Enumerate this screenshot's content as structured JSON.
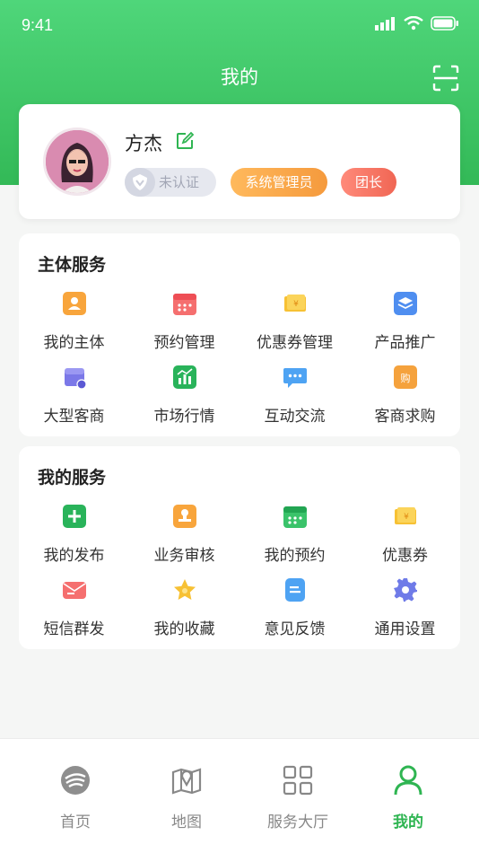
{
  "status_bar": {
    "time": "9:41"
  },
  "header": {
    "title": "我的"
  },
  "profile": {
    "name": "方杰",
    "badges": {
      "verify": "未认证",
      "role": "系统管理员",
      "leader": "团长"
    },
    "avatar_signature": "Linda"
  },
  "sections": {
    "main_services": {
      "title": "主体服务",
      "items": [
        {
          "label": "我的主体",
          "icon": "person-card-icon"
        },
        {
          "label": "预约管理",
          "icon": "calendar-icon"
        },
        {
          "label": "优惠券管理",
          "icon": "coupon-icon"
        },
        {
          "label": "产品推广",
          "icon": "layers-icon"
        },
        {
          "label": "大型客商",
          "icon": "store-icon"
        },
        {
          "label": "市场行情",
          "icon": "chart-icon"
        },
        {
          "label": "互动交流",
          "icon": "chat-icon"
        },
        {
          "label": "客商求购",
          "icon": "purchase-icon"
        }
      ]
    },
    "my_services": {
      "title": "我的服务",
      "items": [
        {
          "label": "我的发布",
          "icon": "plus-icon"
        },
        {
          "label": "业务审核",
          "icon": "stamp-icon"
        },
        {
          "label": "我的预约",
          "icon": "calendar-green-icon"
        },
        {
          "label": "优惠券",
          "icon": "coupon-icon"
        },
        {
          "label": "短信群发",
          "icon": "envelope-icon"
        },
        {
          "label": "我的收藏",
          "icon": "star-icon"
        },
        {
          "label": "意见反馈",
          "icon": "feedback-icon"
        },
        {
          "label": "通用设置",
          "icon": "gear-icon"
        }
      ]
    }
  },
  "tab_bar": {
    "tabs": [
      {
        "label": "首页",
        "icon": "home-logo-icon"
      },
      {
        "label": "地图",
        "icon": "map-icon"
      },
      {
        "label": "服务大厅",
        "icon": "grid-icon"
      },
      {
        "label": "我的",
        "icon": "user-icon",
        "active": true
      }
    ]
  },
  "colors": {
    "brand_green": "#2fb552",
    "admin_orange": "#f59a3d",
    "leader_red": "#f06654"
  }
}
